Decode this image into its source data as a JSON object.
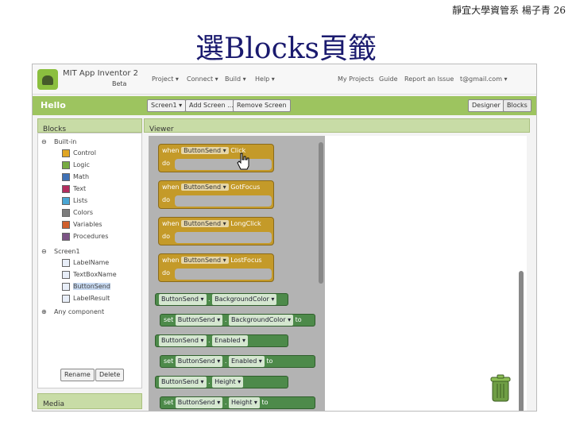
{
  "slide": {
    "header": "靜宜大學資管系 楊子青 26",
    "title": "選Blocks頁籤"
  },
  "app": {
    "name": "MIT App Inventor 2",
    "beta": "Beta",
    "menu": [
      "Project ▾",
      "Connect ▾",
      "Build ▾",
      "Help ▾"
    ],
    "right_menu": [
      "My Projects",
      "Guide",
      "Report an Issue",
      "t@gmail.com ▾"
    ],
    "project_name": "Hello",
    "toolbar": {
      "screen": "Screen1 ▾",
      "add_screen": "Add Screen ...",
      "remove_screen": "Remove Screen",
      "designer": "Designer",
      "blocks": "Blocks"
    },
    "panels": {
      "blocks_title": "Blocks",
      "viewer_title": "Viewer",
      "media_title": "Media"
    },
    "tree": {
      "builtin": "Built-in",
      "builtin_items": [
        {
          "label": "Control",
          "color": "#e0a624"
        },
        {
          "label": "Logic",
          "color": "#77ab41"
        },
        {
          "label": "Math",
          "color": "#3f71b5"
        },
        {
          "label": "Text",
          "color": "#b32d5e"
        },
        {
          "label": "Lists",
          "color": "#49a6d4"
        },
        {
          "label": "Colors",
          "color": "#7d7d7d"
        },
        {
          "label": "Variables",
          "color": "#d05f2d"
        },
        {
          "label": "Procedures",
          "color": "#7c5385"
        }
      ],
      "screen1": "Screen1",
      "components": [
        "LabelName",
        "TextBoxName",
        "ButtonSend",
        "LabelResult"
      ],
      "any_component": "Any component",
      "rename": "Rename",
      "delete": "Delete"
    },
    "event_blocks": [
      {
        "when": "when",
        "component": "ButtonSend ▾",
        "event": "Click",
        "do": "do"
      },
      {
        "when": "when",
        "component": "ButtonSend ▾",
        "event": "GotFocus",
        "do": "do"
      },
      {
        "when": "when",
        "component": "ButtonSend ▾",
        "event": "LongClick",
        "do": "do"
      },
      {
        "when": "when",
        "component": "ButtonSend ▾",
        "event": "LostFocus",
        "do": "do"
      }
    ],
    "property_blocks": [
      {
        "prefix": "",
        "component": "ButtonSend ▾",
        "property": "BackgroundColor ▾",
        "suffix": ""
      },
      {
        "prefix": "set",
        "component": "ButtonSend ▾",
        "property": "BackgroundColor ▾",
        "suffix": "to"
      },
      {
        "prefix": "",
        "component": "ButtonSend ▾",
        "property": "Enabled ▾",
        "suffix": ""
      },
      {
        "prefix": "set",
        "component": "ButtonSend ▾",
        "property": "Enabled ▾",
        "suffix": "to"
      },
      {
        "prefix": "",
        "component": "ButtonSend ▾",
        "property": "Height ▾",
        "suffix": ""
      },
      {
        "prefix": "set",
        "component": "ButtonSend ▾",
        "property": "Height ▾",
        "suffix": "to"
      }
    ]
  }
}
